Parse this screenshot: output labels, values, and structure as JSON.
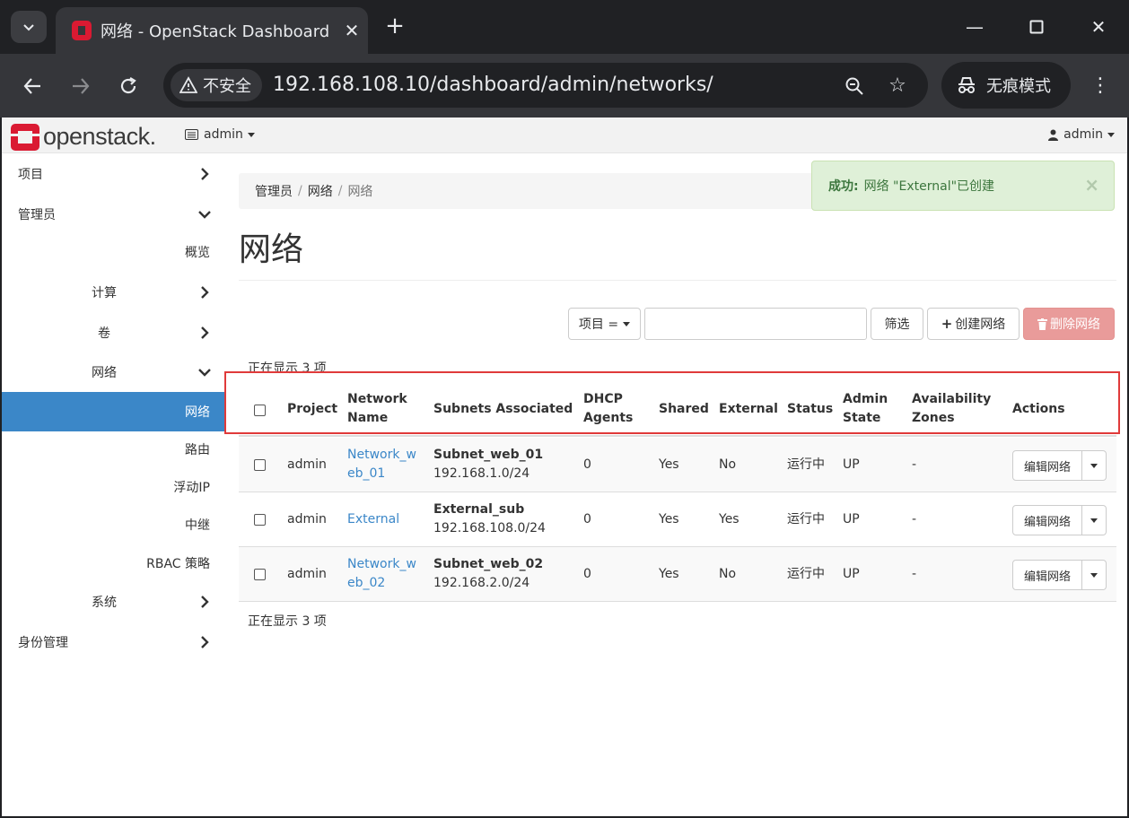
{
  "browser": {
    "tab_title": "网络 - OpenStack Dashboard",
    "security_label": "不安全",
    "url": "192.168.108.10/dashboard/admin/networks/",
    "incognito_label": "无痕模式"
  },
  "topnav": {
    "logo_text": "openstack.",
    "project": "admin",
    "user": "admin"
  },
  "sidebar": {
    "items": [
      {
        "label": "项目"
      },
      {
        "label": "管理员"
      },
      {
        "label": "概览"
      },
      {
        "label": "计算"
      },
      {
        "label": "卷"
      },
      {
        "label": "网络"
      },
      {
        "label": "网络"
      },
      {
        "label": "路由"
      },
      {
        "label": "浮动IP"
      },
      {
        "label": "中继"
      },
      {
        "label": "RBAC 策略"
      },
      {
        "label": "系统"
      },
      {
        "label": "身份管理"
      }
    ]
  },
  "breadcrumb": [
    "管理员",
    "网络",
    "网络"
  ],
  "alert": {
    "prefix": "成功:",
    "message": "网络 \"External\"已创建",
    "close": "×"
  },
  "page_title": "网络",
  "toolbar": {
    "filter_field": "项目 =",
    "filter_value": "",
    "filter_button": "筛选",
    "create_button": "创建网络",
    "delete_button": "删除网络"
  },
  "count_text": "正在显示 3 项",
  "table": {
    "headers": {
      "project": "Project",
      "network_name": [
        "Network",
        "Name"
      ],
      "subnets": "Subnets Associated",
      "dhcp": [
        "DHCP",
        "Agents"
      ],
      "shared": "Shared",
      "external": "External",
      "status": "Status",
      "admin_state": [
        "Admin",
        "State"
      ],
      "zones": [
        "Availability",
        "Zones"
      ],
      "actions": "Actions"
    },
    "rows": [
      {
        "project": "admin",
        "name_l1": "Network_w",
        "name_l2": "eb_01",
        "subnet_name": "Subnet_web_01",
        "subnet_cidr": "192.168.1.0/24",
        "dhcp": "0",
        "shared": "Yes",
        "external": "No",
        "status": "运行中",
        "admin_state": "UP",
        "zones": "-",
        "action": "编辑网络"
      },
      {
        "project": "admin",
        "name_l1": "External",
        "name_l2": "",
        "subnet_name": "External_sub",
        "subnet_cidr": "192.168.108.0/24",
        "dhcp": "0",
        "shared": "Yes",
        "external": "Yes",
        "status": "运行中",
        "admin_state": "UP",
        "zones": "-",
        "action": "编辑网络"
      },
      {
        "project": "admin",
        "name_l1": "Network_w",
        "name_l2": "eb_02",
        "subnet_name": "Subnet_web_02",
        "subnet_cidr": "192.168.2.0/24",
        "dhcp": "0",
        "shared": "Yes",
        "external": "No",
        "status": "运行中",
        "admin_state": "UP",
        "zones": "-",
        "action": "编辑网络"
      }
    ]
  },
  "colors": {
    "accent": "#3b87c8",
    "brand": "#da1a32",
    "success_bg": "#dff0d8",
    "danger": "#e99b9a",
    "highlight": "#e03a3a"
  }
}
